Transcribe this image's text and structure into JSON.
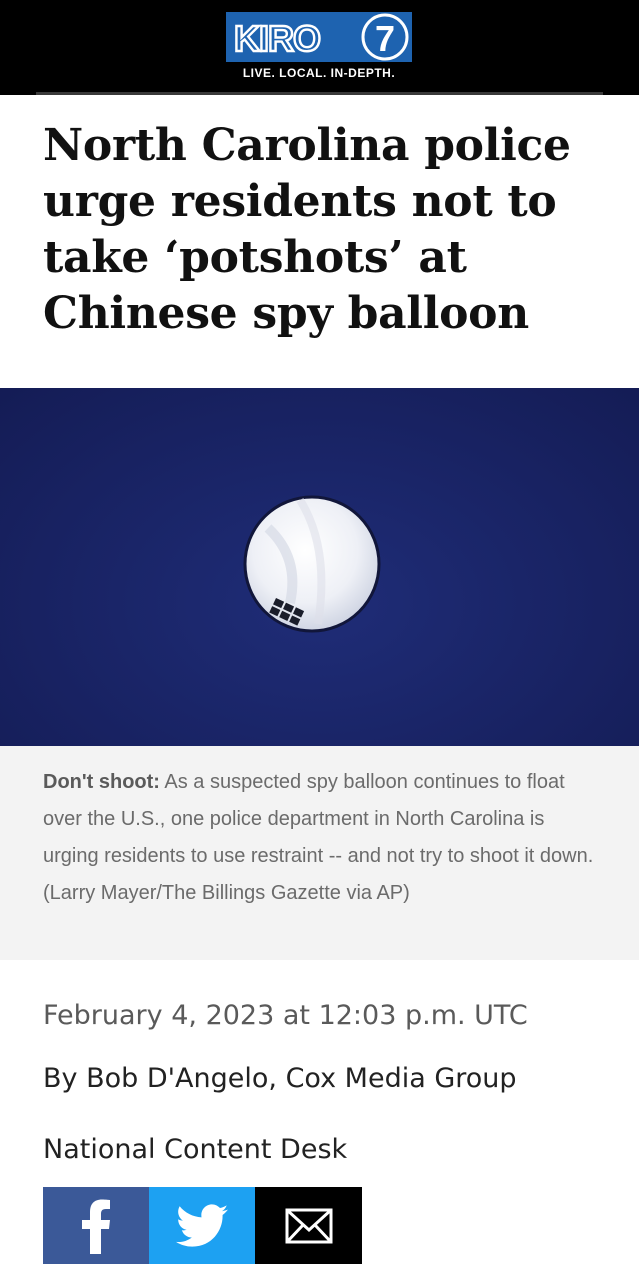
{
  "header": {
    "logo_text": "KIRO",
    "logo_number": "7",
    "tagline": "LIVE. LOCAL. IN-DEPTH."
  },
  "article": {
    "headline": "North Carolina police urge residents not to take ‘potshots’ at Chinese spy balloon",
    "caption_lead": "Don't shoot:",
    "caption_text": " As a suspected spy balloon continues to float over the U.S., one police department in North Carolina is urging residents to use restraint -- and not try to shoot it down. (Larry Mayer/The Billings Gazette via AP)",
    "date": "February 4, 2023 at 12:03 p.m. UTC",
    "byline": "By Bob D'Angelo, Cox Media Group",
    "desk": "National Content Desk"
  },
  "share": {
    "facebook_icon": "facebook-icon",
    "twitter_icon": "twitter-icon",
    "email_icon": "email-icon"
  },
  "colors": {
    "facebook": "#3b5998",
    "twitter": "#1da1f2",
    "sky": "#1a2568",
    "logo_blue": "#1e63b0"
  }
}
